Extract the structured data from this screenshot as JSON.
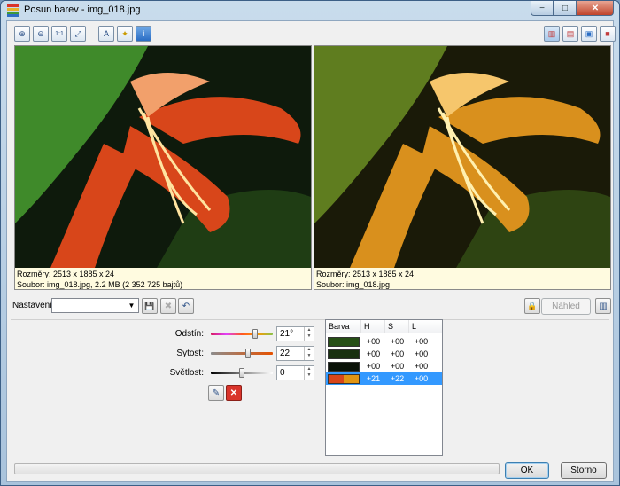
{
  "window": {
    "title": "Posun barev - img_018.jpg",
    "controls": {
      "minimize": "−",
      "maximize": "□",
      "close": "✕"
    }
  },
  "toolbar_left": [
    {
      "name": "zoom-in-icon",
      "glyph": "⊕"
    },
    {
      "name": "zoom-out-icon",
      "glyph": "⊖"
    },
    {
      "name": "actual-size-icon",
      "glyph": "1:1"
    },
    {
      "name": "fit-window-icon",
      "glyph": "⤢"
    },
    {
      "name": "text-icon",
      "glyph": "A"
    },
    {
      "name": "highlight-icon",
      "glyph": "✦"
    },
    {
      "name": "info-icon",
      "glyph": "i"
    }
  ],
  "toolbar_right": [
    {
      "name": "split-vertical-icon",
      "glyph": "▥",
      "active": true
    },
    {
      "name": "split-horizontal-icon",
      "glyph": "▤",
      "active": false
    },
    {
      "name": "single-view-icon",
      "glyph": "▣",
      "active": false
    },
    {
      "name": "fullscreen-icon",
      "glyph": "■",
      "active": false
    }
  ],
  "original": {
    "dims": "Rozměry: 2513 x 1885 x 24",
    "file": "Soubor: img_018.jpg, 2.2 MB (2 352 725 bajtů)",
    "colors": {
      "petal": "#d8461a",
      "petal_light": "#f2a06b",
      "leaf": "#3f8a2a",
      "bg": "#0e1a0c"
    }
  },
  "preview": {
    "dims": "Rozměry: 2513 x 1885 x 24",
    "file": "Soubor: img_018.jpg",
    "colors": {
      "petal": "#d9901d",
      "petal_light": "#f6c66c",
      "leaf": "#5f7d1f",
      "bg": "#1a1a08"
    }
  },
  "settings": {
    "label": "Nastavení:",
    "combo_value": "",
    "save_icon": "💾",
    "delete_icon": "✖",
    "reset_icon": "↶",
    "lock_icon": "🔒",
    "preview_button": "Náhled",
    "compare_icon": "▥"
  },
  "sliders": [
    {
      "label": "Odstín:",
      "value": "21°",
      "level": 0.72,
      "track": "hue"
    },
    {
      "label": "Sytost:",
      "value": "22",
      "level": 0.6,
      "track": "sat"
    },
    {
      "label": "Světlost:",
      "value": "0",
      "level": 0.5,
      "track": "light"
    }
  ],
  "picker_icon": "✎",
  "remove_icon": "✕",
  "table": {
    "headers": [
      "Barva",
      "H",
      "S",
      "L"
    ],
    "rows": [
      {
        "colors": [
          "#264f16"
        ],
        "h": "+00",
        "s": "+00",
        "l": "+00",
        "selected": false
      },
      {
        "colors": [
          "#193010"
        ],
        "h": "+00",
        "s": "+00",
        "l": "+00",
        "selected": false
      },
      {
        "colors": [
          "#0a1208"
        ],
        "h": "+00",
        "s": "+00",
        "l": "+00",
        "selected": false
      },
      {
        "colors": [
          "#d8461a",
          "#e09413"
        ],
        "h": "+21",
        "s": "+22",
        "l": "+00",
        "selected": true
      }
    ]
  },
  "buttons": {
    "ok": "OK",
    "cancel": "Storno"
  }
}
